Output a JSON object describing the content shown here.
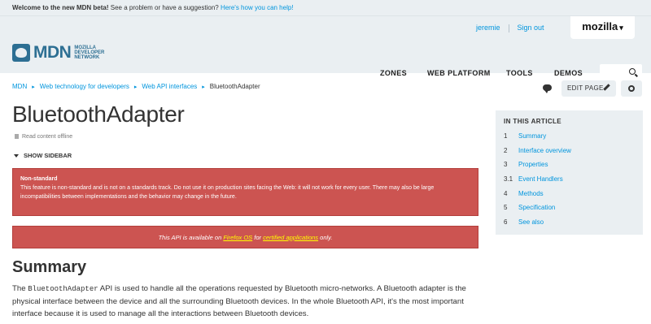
{
  "betabar": {
    "welcome": "Welcome to the new MDN beta!",
    "question": " See a problem or have a suggestion? ",
    "help_link": "Here's how you can help!"
  },
  "header": {
    "user": "jeremie",
    "signout": "Sign out",
    "mozilla": "mozilla",
    "logo_text": "MDN",
    "logo_sub": "MOZILLA DEVELOPER NETWORK",
    "nav": [
      "ZONES",
      "WEB PLATFORM",
      "TOOLS",
      "DEMOS"
    ]
  },
  "breadcrumb": [
    "MDN",
    "Web technology for developers",
    "Web API interfaces",
    "BluetoothAdapter"
  ],
  "actions": {
    "edit_page": "EDIT PAGE"
  },
  "page": {
    "title": "BluetoothAdapter",
    "offline": "Read content offline",
    "show_sidebar": "SHOW SIDEBAR"
  },
  "notices": {
    "nonstandard_title": "Non-standard",
    "nonstandard_body": "This feature is non-standard and is not on a standards track. Do not use it on production sites facing the Web: it will not work for every user. There may also be large incompatibilities between implementations and the behavior may change in the future.",
    "api_pre": "This API is available on ",
    "api_link1": "Firefox OS",
    "api_mid": " for ",
    "api_link2": "certified applications",
    "api_post": " only."
  },
  "summary": {
    "heading": "Summary",
    "pre": "The ",
    "code": "BluetoothAdapter",
    "post": " API is used to handle all the operations requested by Bluetooth micro-networks. A Bluetooth adapter is the physical interface between the device and all the surrounding Bluetooth devices. In the whole Bluetooth API, it's the most important interface because it is used to manage all the interactions between Bluetooth devices."
  },
  "toc": {
    "heading": "IN THIS ARTICLE",
    "items": [
      {
        "num": "1",
        "label": "Summary"
      },
      {
        "num": "2",
        "label": "Interface overview"
      },
      {
        "num": "3",
        "label": "Properties"
      },
      {
        "num": "3.1",
        "label": "Event Handlers"
      },
      {
        "num": "4",
        "label": "Methods"
      },
      {
        "num": "5",
        "label": "Specification"
      },
      {
        "num": "6",
        "label": "See also"
      }
    ]
  },
  "colors": {
    "accent": "#0095dd",
    "brand": "#2d6f93",
    "notice_bg": "#cc5451",
    "header_bg": "#eaeff2"
  }
}
